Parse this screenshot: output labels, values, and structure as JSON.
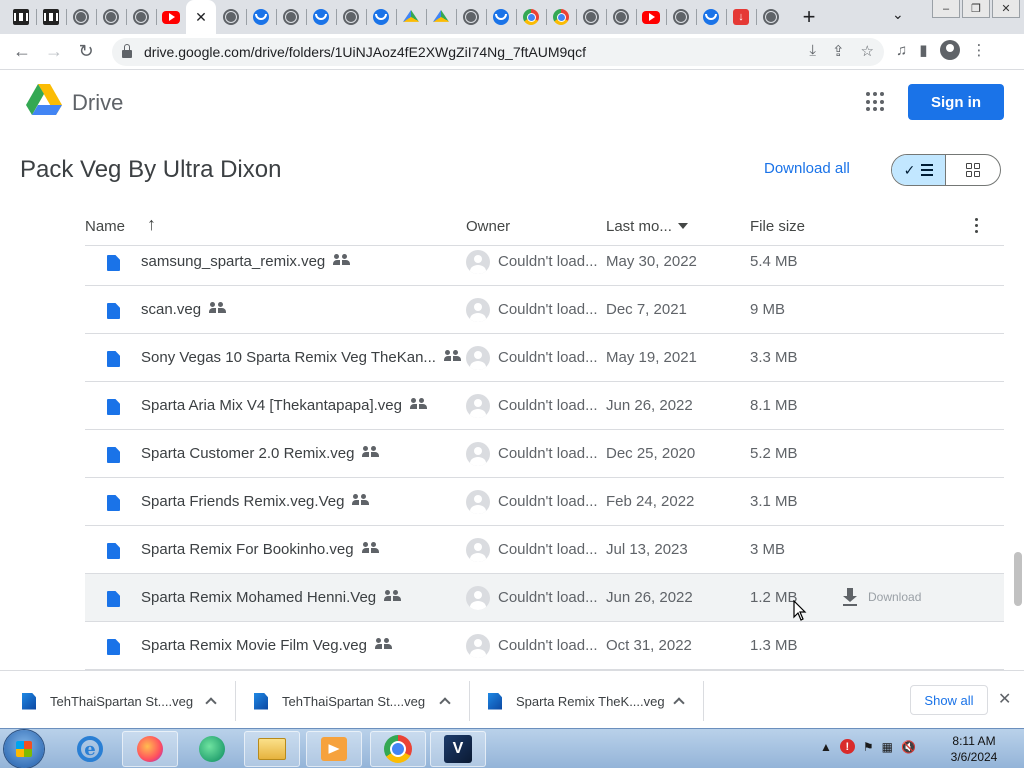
{
  "browser": {
    "tabs": [
      "archive-icon",
      "archive-icon",
      "globe-icon",
      "globe-icon",
      "globe-icon",
      "youtube-icon",
      "active",
      "globe-icon",
      "blue-c-icon",
      "globe-icon",
      "blue-c-icon",
      "globe-icon",
      "blue-c-icon",
      "drive-icon",
      "drive-icon",
      "globe-icon",
      "blue-c-icon",
      "chrome-icon",
      "chrome-icon",
      "globe-icon",
      "globe-icon",
      "youtube-icon",
      "globe-icon",
      "blue-c-icon",
      "download-icon",
      "globe-icon"
    ],
    "url": "drive.google.com/drive/folders/1UiNJAoz4fE2XWgZiI74Ng_7ftAUM9qcf"
  },
  "drive": {
    "product_name": "Drive",
    "sign_in_label": "Sign in",
    "folder_title": "Pack Veg By Ultra Dixon",
    "download_all_label": "Download all"
  },
  "table": {
    "headers": {
      "name": "Name",
      "owner": "Owner",
      "modified": "Last mo...",
      "size": "File size"
    },
    "rows": [
      {
        "name": "samsung_sparta_remix.veg",
        "owner": "Couldn't load...",
        "modified": "May 30, 2022",
        "size": "5.4 MB"
      },
      {
        "name": "scan.veg",
        "owner": "Couldn't load...",
        "modified": "Dec 7, 2021",
        "size": "9 MB"
      },
      {
        "name": "Sony Vegas 10 Sparta Remix Veg TheKan...",
        "owner": "Couldn't load...",
        "modified": "May 19, 2021",
        "size": "3.3 MB"
      },
      {
        "name": "Sparta Aria Mix V4 [Thekantapapa].veg",
        "owner": "Couldn't load...",
        "modified": "Jun 26, 2022",
        "size": "8.1 MB"
      },
      {
        "name": "Sparta Customer 2.0 Remix.veg",
        "owner": "Couldn't load...",
        "modified": "Dec 25, 2020",
        "size": "5.2 MB"
      },
      {
        "name": "Sparta Friends Remix.veg.Veg",
        "owner": "Couldn't load...",
        "modified": "Feb 24, 2022",
        "size": "3.1 MB"
      },
      {
        "name": "Sparta Remix For Bookinho.veg",
        "owner": "Couldn't load...",
        "modified": "Jul 13, 2023",
        "size": "3 MB"
      },
      {
        "name": "Sparta Remix Mohamed Henni.Veg",
        "owner": "Couldn't load...",
        "modified": "Jun 26, 2022",
        "size": "1.2 MB",
        "hover_action": "Download"
      },
      {
        "name": "Sparta Remix Movie Film Veg.veg",
        "owner": "Couldn't load...",
        "modified": "Oct 31, 2022",
        "size": "1.3 MB"
      }
    ]
  },
  "downloads": {
    "items": [
      "TehThaiSpartan St....veg",
      "TehThaiSpartan St....veg",
      "Sparta Remix TheK....veg"
    ],
    "show_all_label": "Show all"
  },
  "taskbar": {
    "time": "8:11 AM",
    "date": "3/6/2024"
  },
  "colors": {
    "accent": "#1a73e8",
    "toggle_active": "#c2e7ff"
  }
}
